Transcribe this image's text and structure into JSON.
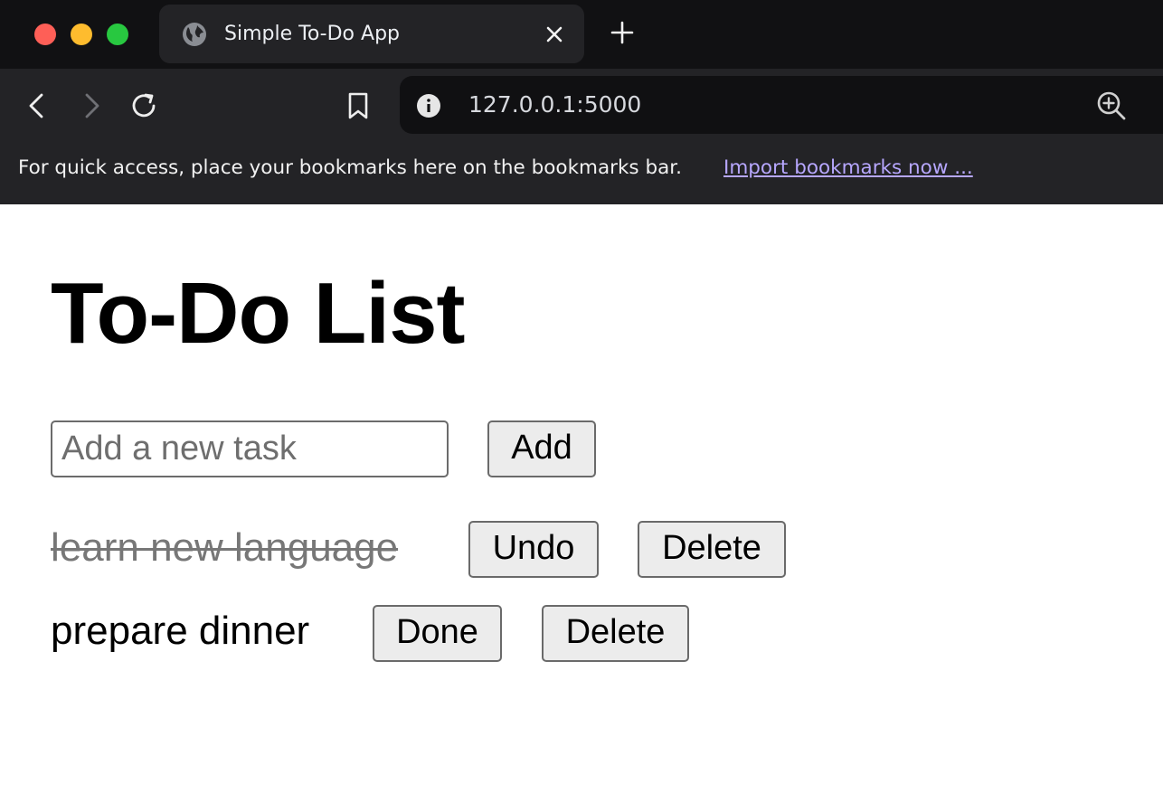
{
  "browser": {
    "tab": {
      "title": "Simple To-Do App"
    },
    "address_bar": {
      "url": "127.0.0.1:5000"
    },
    "bookmarks_bar": {
      "message": "For quick access, place your bookmarks here on the bookmarks bar.",
      "import_link": "Import bookmarks now ..."
    },
    "colors": {
      "tabstrip_bg": "#111113",
      "toolbar_bg": "#232326",
      "omnibox_bg": "#101012",
      "link": "#b7a7ff",
      "close_red": "#fe5f57",
      "minimize_yellow": "#febc2e",
      "maximize_green": "#28c840"
    },
    "icons": [
      "globe-icon",
      "close-icon",
      "plus-icon",
      "back-arrow-icon",
      "forward-arrow-icon",
      "reload-icon",
      "bookmark-icon",
      "info-icon",
      "zoom-in-icon"
    ]
  },
  "page": {
    "title": "To-Do List",
    "new_task": {
      "placeholder": "Add a new task",
      "value": ""
    },
    "add_label": "Add",
    "tasks": [
      {
        "text": "learn new language",
        "completed": true,
        "toggle_label": "Undo",
        "delete_label": "Delete"
      },
      {
        "text": "prepare dinner",
        "completed": false,
        "toggle_label": "Done",
        "delete_label": "Delete"
      }
    ]
  }
}
